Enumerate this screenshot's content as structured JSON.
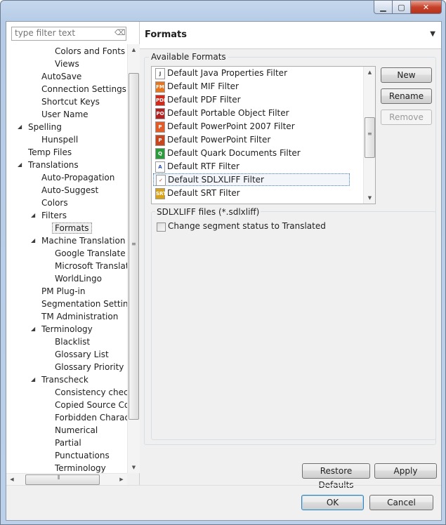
{
  "window": {
    "min_icon": "minimize-icon",
    "max_icon": "maximize-icon",
    "close_icon": "close-icon"
  },
  "filter": {
    "placeholder": "type filter text",
    "clear_icon": "clear-filter-icon"
  },
  "tree": [
    {
      "label": "Colors and Fonts",
      "level": 3,
      "arrow": ""
    },
    {
      "label": "Views",
      "level": 3,
      "arrow": ""
    },
    {
      "label": "AutoSave",
      "level": 2,
      "arrow": ""
    },
    {
      "label": "Connection Settings",
      "level": 2,
      "arrow": ""
    },
    {
      "label": "Shortcut Keys",
      "level": 2,
      "arrow": ""
    },
    {
      "label": "User Name",
      "level": 2,
      "arrow": ""
    },
    {
      "label": "Spelling",
      "level": 1,
      "arrow": "expanded"
    },
    {
      "label": "Hunspell",
      "level": 2,
      "arrow": ""
    },
    {
      "label": "Temp Files",
      "level": 1,
      "arrow": ""
    },
    {
      "label": "Translations",
      "level": 1,
      "arrow": "expanded"
    },
    {
      "label": "Auto-Propagation",
      "level": 2,
      "arrow": ""
    },
    {
      "label": "Auto-Suggest",
      "level": 2,
      "arrow": ""
    },
    {
      "label": "Colors",
      "level": 2,
      "arrow": ""
    },
    {
      "label": "Filters",
      "level": 2,
      "arrow": "expanded"
    },
    {
      "label": "Formats",
      "level": 3,
      "arrow": "",
      "selected": true
    },
    {
      "label": "Machine Translation",
      "level": 2,
      "arrow": "expanded"
    },
    {
      "label": "Google Translate",
      "level": 3,
      "arrow": ""
    },
    {
      "label": "Microsoft Translator",
      "level": 3,
      "arrow": ""
    },
    {
      "label": "WorldLingo",
      "level": 3,
      "arrow": ""
    },
    {
      "label": "PM Plug-in",
      "level": 2,
      "arrow": ""
    },
    {
      "label": "Segmentation Settings",
      "level": 2,
      "arrow": ""
    },
    {
      "label": "TM Administration",
      "level": 2,
      "arrow": ""
    },
    {
      "label": "Terminology",
      "level": 2,
      "arrow": "expanded"
    },
    {
      "label": "Blacklist",
      "level": 3,
      "arrow": ""
    },
    {
      "label": "Glossary List",
      "level": 3,
      "arrow": ""
    },
    {
      "label": "Glossary Priority",
      "level": 3,
      "arrow": ""
    },
    {
      "label": "Transcheck",
      "level": 2,
      "arrow": "expanded"
    },
    {
      "label": "Consistency check",
      "level": 3,
      "arrow": ""
    },
    {
      "label": "Copied Source Content",
      "level": 3,
      "arrow": ""
    },
    {
      "label": "Forbidden Characters",
      "level": 3,
      "arrow": ""
    },
    {
      "label": "Numerical",
      "level": 3,
      "arrow": ""
    },
    {
      "label": "Partial",
      "level": 3,
      "arrow": ""
    },
    {
      "label": "Punctuations",
      "level": 3,
      "arrow": ""
    },
    {
      "label": "Terminology",
      "level": 3,
      "arrow": ""
    }
  ],
  "header": {
    "title": "Formats",
    "menu_icon": "view-menu-icon"
  },
  "available_formats": {
    "label": "Available Formats",
    "items": [
      {
        "label": "Default Java Properties Filter",
        "icon": "java-file-icon",
        "glyph": "J",
        "color": "#4a4a4a",
        "bg": "#ffffff"
      },
      {
        "label": "Default MIF Filter",
        "icon": "framemaker-icon",
        "glyph": "FM",
        "color": "#ffffff",
        "bg": "#e8741c"
      },
      {
        "label": "Default PDF Filter",
        "icon": "pdf-icon",
        "glyph": "PDF",
        "color": "#ffffff",
        "bg": "#d02a1e"
      },
      {
        "label": "Default Portable Object Filter",
        "icon": "po-file-icon",
        "glyph": "PO",
        "color": "#ffffff",
        "bg": "#b22222"
      },
      {
        "label": "Default PowerPoint 2007 Filter",
        "icon": "powerpoint-2007-icon",
        "glyph": "P",
        "color": "#ffffff",
        "bg": "#e05c28"
      },
      {
        "label": "Default PowerPoint Filter",
        "icon": "powerpoint-icon",
        "glyph": "P",
        "color": "#ffffff",
        "bg": "#c8461d"
      },
      {
        "label": "Default Quark Documents Filter",
        "icon": "quark-icon",
        "glyph": "Q",
        "color": "#ffffff",
        "bg": "#2e9a3e"
      },
      {
        "label": "Default RTF Filter",
        "icon": "rtf-icon",
        "glyph": "A",
        "color": "#2a4fb3",
        "bg": "#ffffff"
      },
      {
        "label": "Default SDLXLIFF Filter",
        "icon": "sdlxliff-icon",
        "glyph": "✓",
        "color": "#d02a1e",
        "bg": "#ffffff",
        "selected": true
      },
      {
        "label": "Default SRT Filter",
        "icon": "srt-icon",
        "glyph": "SRT",
        "color": "#ffffff",
        "bg": "#d9a21b"
      }
    ]
  },
  "buttons": {
    "new": "New",
    "rename": "Rename",
    "remove": "Remove",
    "restore": "Restore Defaults",
    "apply": "Apply",
    "ok": "OK",
    "cancel": "Cancel"
  },
  "file_type": {
    "label": "SDLXLIFF files (*.sdlxliff)",
    "checkbox_label": "Change segment status to Translated",
    "checked": false
  }
}
